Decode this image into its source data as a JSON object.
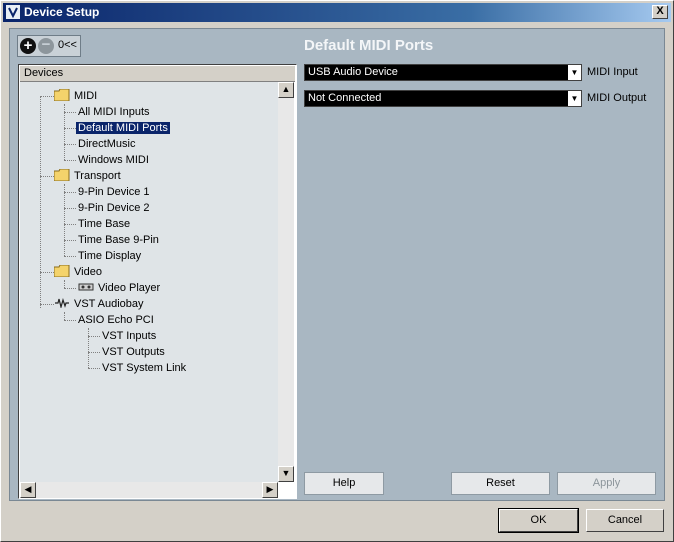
{
  "window": {
    "title": "Device Setup",
    "close_label": "X"
  },
  "toolbar": {
    "add_label": "+",
    "remove_label": "−",
    "reset_label": "0<<"
  },
  "tree": {
    "header": "Devices",
    "items": [
      {
        "label": "MIDI"
      },
      {
        "label": "All MIDI Inputs"
      },
      {
        "label": "Default MIDI Ports"
      },
      {
        "label": "DirectMusic"
      },
      {
        "label": "Windows MIDI"
      },
      {
        "label": "Transport"
      },
      {
        "label": "9-Pin Device 1"
      },
      {
        "label": "9-Pin Device 2"
      },
      {
        "label": "Time Base"
      },
      {
        "label": "Time Base 9-Pin"
      },
      {
        "label": "Time Display"
      },
      {
        "label": "Video"
      },
      {
        "label": "Video Player"
      },
      {
        "label": "VST Audiobay"
      },
      {
        "label": "ASIO Echo PCI"
      },
      {
        "label": "VST Inputs"
      },
      {
        "label": "VST Outputs"
      },
      {
        "label": "VST System Link"
      }
    ]
  },
  "panel": {
    "title": "Default MIDI Ports",
    "midi_input_value": "USB Audio Device",
    "midi_input_label": "MIDI Input",
    "midi_output_value": "Not Connected",
    "midi_output_label": "MIDI Output"
  },
  "buttons": {
    "help": "Help",
    "reset": "Reset",
    "apply": "Apply",
    "ok": "OK",
    "cancel": "Cancel"
  },
  "colors": {
    "title_bar": "#0a246a",
    "selection": "#0a246a",
    "panel_bg": "#a9b7c2"
  }
}
